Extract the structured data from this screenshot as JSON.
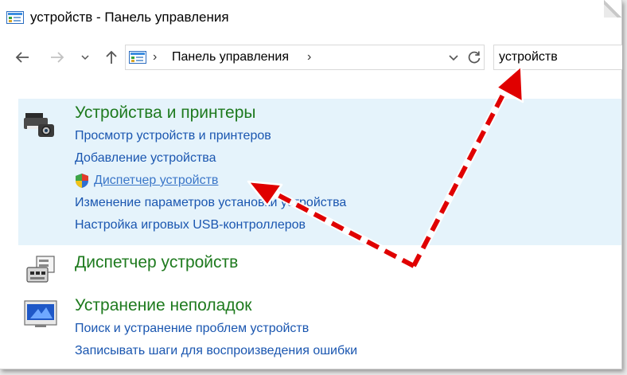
{
  "window": {
    "title": "устройств - Панель управления"
  },
  "nav": {
    "back_icon": "arrow-left-icon",
    "forward_icon": "arrow-right-icon",
    "recent_icon": "chevron-down-icon",
    "up_icon": "arrow-up-icon"
  },
  "address": {
    "separator": "›",
    "path": "Панель управления",
    "separator2": "›"
  },
  "search": {
    "value": "устройств"
  },
  "groups": [
    {
      "title": "Устройства и принтеры",
      "icon": "printer-camera-icon",
      "links": [
        "Просмотр устройств и принтеров",
        "Добавление устройства",
        "Диспетчер устройств",
        "Изменение параметров установки устройства",
        "Настройка игровых USB-контроллеров"
      ]
    },
    {
      "title": "Диспетчер устройств",
      "icon": "device-manager-icon",
      "links": []
    },
    {
      "title": "Устранение неполадок",
      "icon": "troubleshooting-icon",
      "links": [
        "Поиск и устранение проблем устройств",
        "Записывать шаги для воспроизведения ошибки"
      ]
    }
  ],
  "colors": {
    "group_title": "#1e7a1e",
    "link": "#1a56b0",
    "highlight": "#e5f3fb",
    "arrow": "#e00000"
  }
}
